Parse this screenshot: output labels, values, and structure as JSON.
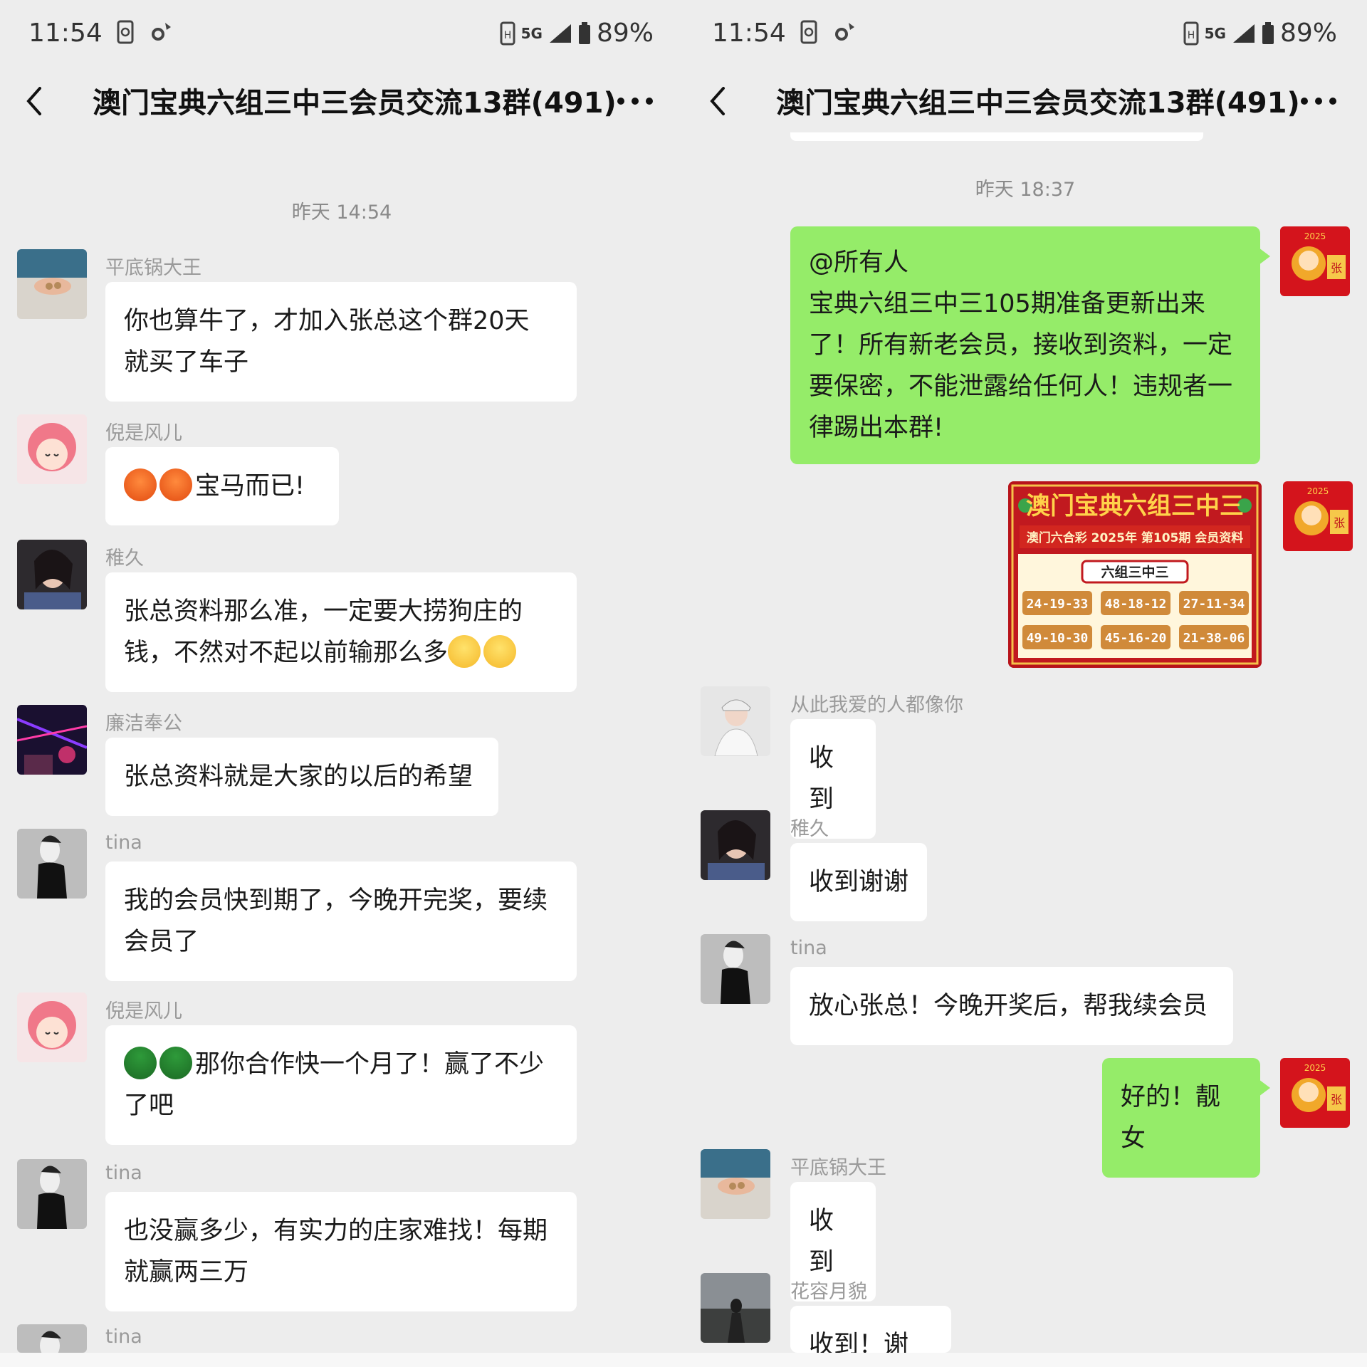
{
  "left": {
    "status": {
      "time": "11:54",
      "network": "5G",
      "battery": "89%"
    },
    "title": "澳门宝典六组三中三会员交流13群(491)",
    "timestamp": "昨天 14:54",
    "messages": [
      {
        "sender": "平底锅大王",
        "line1": "你也算牛了，才加入张总这个群20天",
        "line2": "就买了车子"
      },
      {
        "sender": "倪是风儿",
        "line1": "宝马而已!"
      },
      {
        "sender": "稚久",
        "line1": "张总资料那么准，一定要大捞狗庄的",
        "line2": "钱，不然对不起以前输那么多"
      },
      {
        "sender": "廉洁奉公",
        "line1": "张总资料就是大家的以后的希望"
      },
      {
        "sender": "tina",
        "line1": "我的会员快到期了，今晚开完奖，要续",
        "line2": "会员了"
      },
      {
        "sender": "倪是风儿",
        "line1": "那你合作快一个月了！赢了不少",
        "line2": "了吧"
      },
      {
        "sender": "tina",
        "line1": "也没赢多少，有实力的庄家难找！每期",
        "line2": "就赢两三万"
      },
      {
        "sender": "tina"
      }
    ]
  },
  "right": {
    "status": {
      "time": "11:54",
      "network": "5G",
      "battery": "89%"
    },
    "title": "澳门宝典六组三中三会员交流13群(491)",
    "timestamp": "昨天 18:37",
    "announcement": {
      "line1": "@所有人",
      "line2": "宝典六组三中三105期准备更新出来",
      "line3": "了！所有新老会员，接收到资料，一定",
      "line4": "要保密，不能泄露给任何人！违规者一",
      "line5": "律踢出本群!"
    },
    "card": {
      "title": "澳门宝典六组三中三",
      "subtitle": "澳门六合彩 2025年 第105期 会员资料",
      "label": "六组三中三",
      "groups": [
        "24-19-33",
        "48-18-12",
        "27-11-34",
        "49-10-30",
        "45-16-20",
        "21-38-06"
      ]
    },
    "avatar_text": {
      "year": "2025",
      "char": "张"
    },
    "messages": [
      {
        "sender": "从此我爱的人都像你",
        "text": "收到"
      },
      {
        "sender": "稚久",
        "text": "收到谢谢"
      },
      {
        "sender": "tina",
        "text": "放心张总！今晚开奖后，帮我续会员"
      },
      {
        "self": true,
        "text": "好的！靓女"
      },
      {
        "sender": "平底锅大王",
        "text": "收到"
      },
      {
        "sender": "花容月貌",
        "text": "收到！谢谢"
      }
    ]
  },
  "colors": {
    "bg": "#ededed",
    "bubble": "#ffffff",
    "self_bubble": "#95ec69",
    "timestamp": "#8a8a8a",
    "sender": "#9a9a9a"
  }
}
